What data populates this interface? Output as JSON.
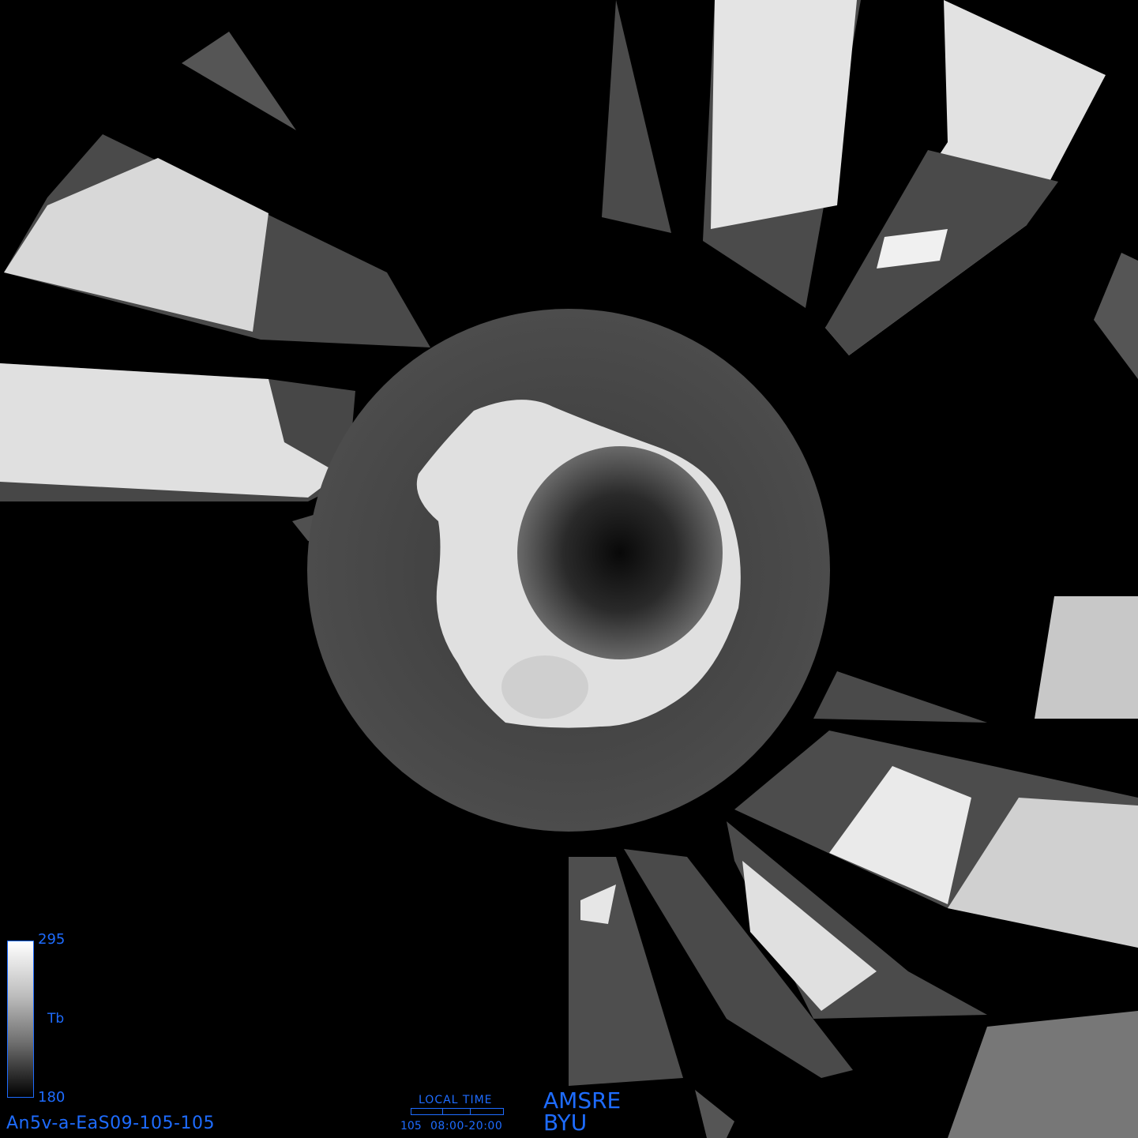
{
  "colorbar": {
    "max_label": "295",
    "min_label": "180",
    "variable_label": "Tb",
    "max_value": 295,
    "min_value": 180
  },
  "file_id": "An5v-a-EaS09-105-105",
  "local_time": {
    "title": "LOCAL TIME",
    "day": "105",
    "range": "08:00-20:00"
  },
  "sensor": "AMSRE",
  "organization": "BYU",
  "colors": {
    "label_blue": "#1e6cff",
    "background": "#000000"
  }
}
